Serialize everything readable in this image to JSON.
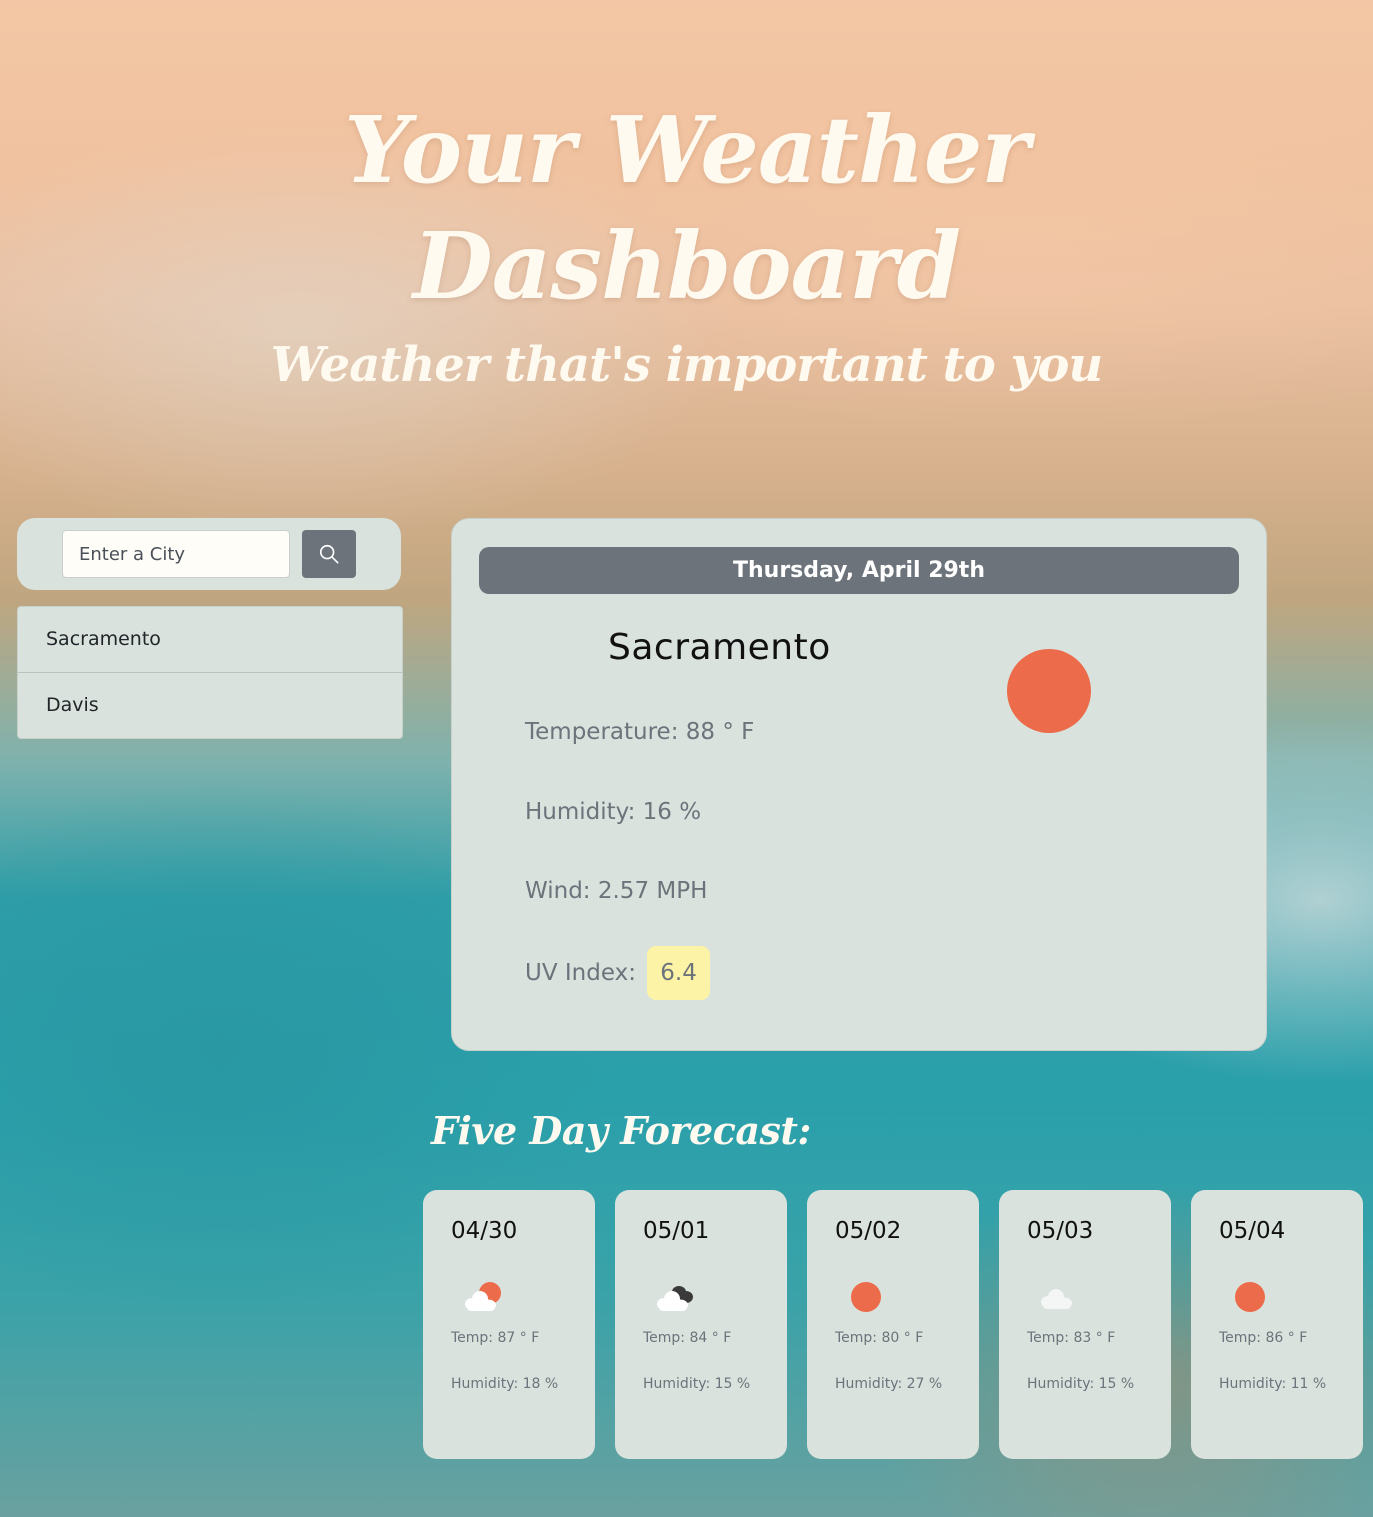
{
  "header": {
    "title": "Your Weather Dashboard",
    "title_line1": "Your Weather",
    "title_line2": "Dashboard",
    "subtitle": "Weather that's important to you"
  },
  "search": {
    "placeholder": "Enter a City",
    "value": "",
    "button_icon": "search-icon"
  },
  "history": {
    "cities": [
      {
        "label": "Sacramento"
      },
      {
        "label": "Davis"
      }
    ]
  },
  "current": {
    "date": "Thursday, April 29th",
    "city": "Sacramento",
    "icon": "sun-icon",
    "temperature_text": "Temperature: 88 ° F",
    "humidity_text": "Humidity: 16 %",
    "wind_text": "Wind: 2.57 MPH",
    "uv_label": "UV Index:",
    "uv_value": "6.4",
    "uv_color": "#fdf3a6"
  },
  "forecast": {
    "title": "Five Day Forecast:",
    "days": [
      {
        "date": "04/30",
        "icon": "partly-sunny-icon",
        "temp": "Temp: 87 ° F",
        "humidity": "Humidity: 18 %"
      },
      {
        "date": "05/01",
        "icon": "cloudy-dark-icon",
        "temp": "Temp: 84 ° F",
        "humidity": "Humidity: 15 %"
      },
      {
        "date": "05/02",
        "icon": "sun-icon",
        "temp": "Temp: 80 ° F",
        "humidity": "Humidity: 27 %"
      },
      {
        "date": "05/03",
        "icon": "cloud-icon",
        "temp": "Temp: 83 ° F",
        "humidity": "Humidity: 15 %"
      },
      {
        "date": "05/04",
        "icon": "sun-icon",
        "temp": "Temp: 86 ° F",
        "humidity": "Humidity: 11 %"
      }
    ]
  },
  "colors": {
    "card": "#dae2dd",
    "accent_gray": "#6c737b",
    "sun": "#ec6b4a",
    "uv_badge": "#fdf3a6"
  }
}
